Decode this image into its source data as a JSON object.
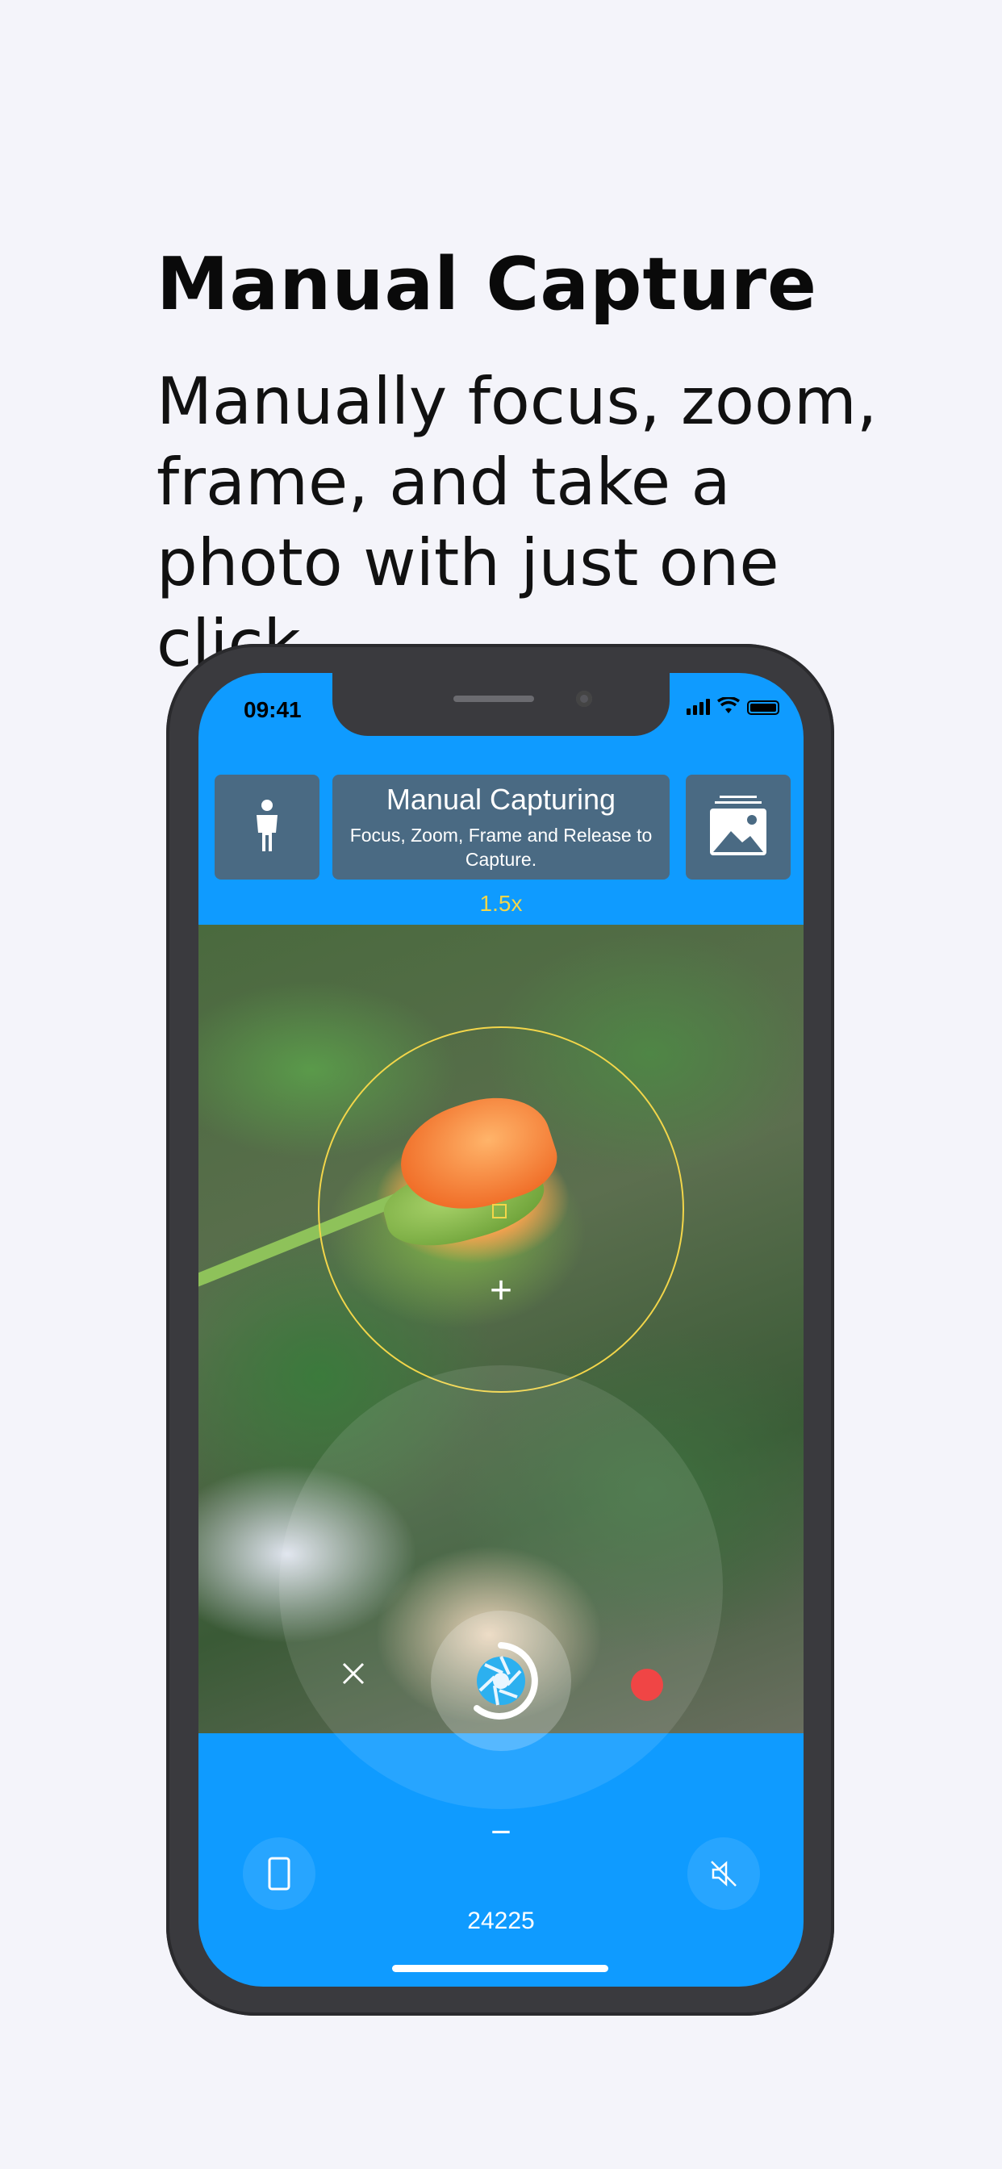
{
  "promo": {
    "headline": "Manual Capture",
    "subtitle": "Manually focus, zoom, frame, and take a photo with just one click."
  },
  "status_bar": {
    "time": "09:41",
    "icons": [
      "signal-icon",
      "wifi-icon",
      "battery-icon"
    ]
  },
  "header": {
    "left_icon": "person-icon",
    "title": "Manual Capturing",
    "description": "Focus, Zoom, Frame and Release to Capture.",
    "right_icon": "gallery-icon"
  },
  "camera": {
    "zoom_level": "1.5x",
    "zoom_in_label": "+",
    "zoom_out_label": "−",
    "close_icon": "close-icon",
    "shutter_icon": "shutter-icon",
    "record_icon": "record-dot-icon",
    "frame_icon": "frame-icon",
    "mute_icon": "mute-icon",
    "counter": "24225"
  },
  "colors": {
    "screen_blue": "#0f9bff",
    "tile_slate": "#4a6a83",
    "focus_yellow": "#f3d64a",
    "record_red": "#f04545"
  }
}
